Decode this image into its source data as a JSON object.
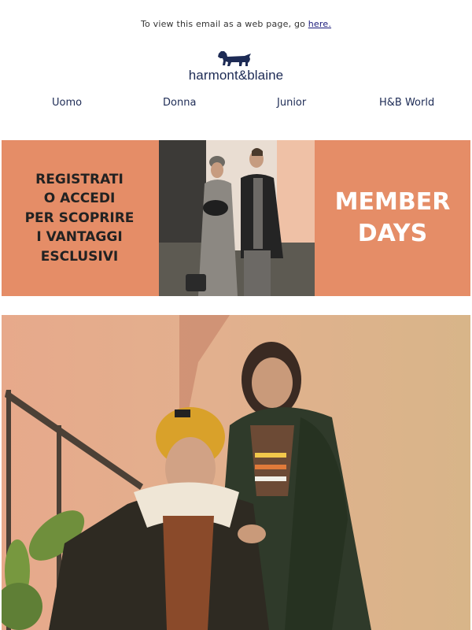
{
  "preheader": {
    "text": "To view this email as a web page, go ",
    "link": "here."
  },
  "brand": {
    "name": "harmont&blaine",
    "logo_icon": "dachshund-icon",
    "color": "#1d2b55"
  },
  "nav": {
    "items": [
      "Uomo",
      "Donna",
      "Junior",
      "H&B World"
    ]
  },
  "banner": {
    "left_text": "REGISTRATI\nO ACCEDI\nPER SCOPRIRE\nI VANTAGGI\nESCLUSIVI",
    "right_text": "MEMBER\nDAYS",
    "background": "#e58d67"
  },
  "hero": {
    "image": "couple-in-winter-jackets-photo"
  }
}
